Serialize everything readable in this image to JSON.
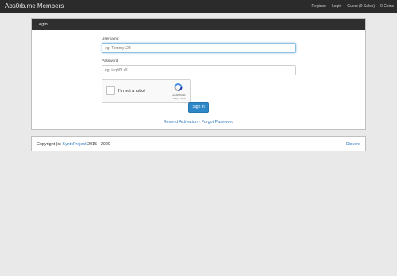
{
  "navbar": {
    "brand": "Abs0rb.me Members",
    "items": [
      "Register",
      "Login",
      "Guest (0 Sales)",
      "0 Coins"
    ]
  },
  "login_panel": {
    "title": "Login",
    "username_label": "Username:",
    "username_placeholder": "eg. Tommy123",
    "password_label": "Password:",
    "password_placeholder": "eg. iuq90Lz!U",
    "captcha": {
      "checkbox_label": "I'm not a robot",
      "brand": "reCAPTCHA",
      "links": "Privacy - Terms"
    },
    "signin_label": "Sign in",
    "resend_label": "Resend Activation",
    "separator": " - ",
    "forgot_label": "Forgot Password"
  },
  "footer": {
    "copyright_prefix": "Copyright (c) ",
    "copyright_link": "SyntxProject",
    "copyright_suffix": " 2015 - 2020",
    "discord_label": "Discord"
  },
  "colors": {
    "navbar_bg": "#2b2b2b",
    "link": "#3a7ebf",
    "button": "#2e87c7",
    "page_bg": "#e9e9e9"
  }
}
